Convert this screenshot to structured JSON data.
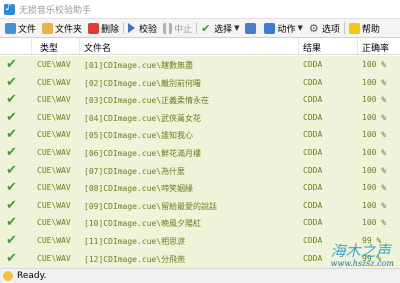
{
  "window": {
    "title": "无损音乐校验助手"
  },
  "toolbar": {
    "file": "文件",
    "folder": "文件夹",
    "delete": "删除",
    "verify": "校验",
    "stop": "中止",
    "select": "选择",
    "save": "",
    "action": "动作",
    "options": "选项",
    "help": "帮助"
  },
  "columns": {
    "type": "类型",
    "filename": "文件名",
    "result": "结果",
    "accuracy": "正确率"
  },
  "rows": [
    {
      "type": "CUE\\WAV",
      "name": "[01]CDImage.cue\\瞎數無盡",
      "result": "CDDA",
      "pct": "100 %"
    },
    {
      "type": "CUE\\WAV",
      "name": "[02]CDImage.cue\\離別前何曙",
      "result": "CDDA",
      "pct": "100 %"
    },
    {
      "type": "CUE\\WAV",
      "name": "[03]CDImage.cue\\正義柔情永在",
      "result": "CDDA",
      "pct": "100 %"
    },
    {
      "type": "CUE\\WAV",
      "name": "[04]CDImage.cue\\武俠萬女花",
      "result": "CDDA",
      "pct": "100 %"
    },
    {
      "type": "CUE\\WAV",
      "name": "[05]CDImage.cue\\誰知我心",
      "result": "CDDA",
      "pct": "100 %"
    },
    {
      "type": "CUE\\WAV",
      "name": "[06]CDImage.cue\\鮮花滿月樓",
      "result": "CDDA",
      "pct": "100 %"
    },
    {
      "type": "CUE\\WAV",
      "name": "[07]CDImage.cue\\為什麼",
      "result": "CDDA",
      "pct": "100 %"
    },
    {
      "type": "CUE\\WAV",
      "name": "[08]CDImage.cue\\啼笑姻緣",
      "result": "CDDA",
      "pct": "100 %"
    },
    {
      "type": "CUE\\WAV",
      "name": "[09]CDImage.cue\\留給最愛的說話",
      "result": "CDDA",
      "pct": "100 %"
    },
    {
      "type": "CUE\\WAV",
      "name": "[10]CDImage.cue\\晚風夕陽紅",
      "result": "CDDA",
      "pct": "100 %"
    },
    {
      "type": "CUE\\WAV",
      "name": "[11]CDImage.cue\\相思淚",
      "result": "CDDA",
      "pct": "99 %"
    },
    {
      "type": "CUE\\WAV",
      "name": "[12]CDImage.cue\\分飛燕",
      "result": "CDDA",
      "pct": "99 %"
    }
  ],
  "status": {
    "text": "Ready."
  },
  "watermark": {
    "name": "海木之声",
    "url": "www.hszsz.com"
  }
}
